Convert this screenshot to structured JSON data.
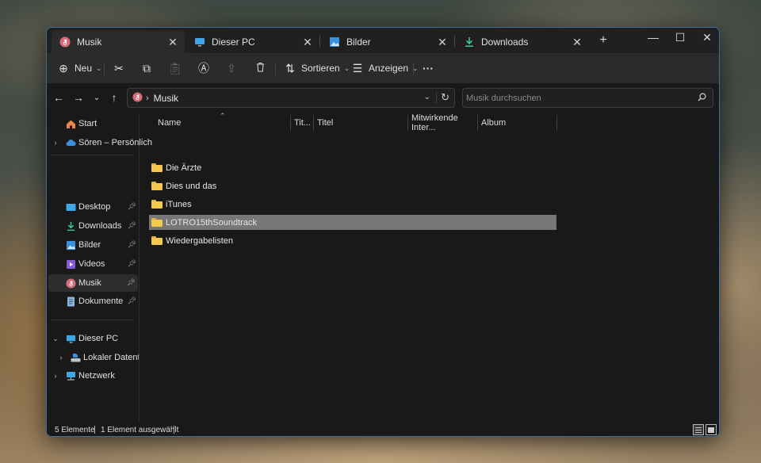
{
  "tabs": [
    {
      "label": "Musik",
      "icon": "music-folder-icon",
      "close": "✕"
    },
    {
      "label": "Dieser PC",
      "icon": "computer-icon",
      "close": "✕"
    },
    {
      "label": "Bilder",
      "icon": "pictures-icon",
      "close": "✕"
    },
    {
      "label": "Downloads",
      "icon": "download-icon",
      "close": "✕"
    }
  ],
  "window_controls": {
    "new_tab": "+",
    "minimize": "—",
    "maximize": "☐",
    "close": "✕"
  },
  "toolbar": {
    "new_label": "Neu",
    "sort_label": "Sortieren",
    "view_label": "Anzeigen",
    "more_label": "···"
  },
  "addressbar": {
    "crumb": "Musik",
    "crumb_sep": "›"
  },
  "search": {
    "placeholder": "Musik durchsuchen"
  },
  "sidebar": {
    "items": [
      {
        "label": "Start"
      },
      {
        "label": "Sören – Persönlich"
      },
      {
        "label": "Desktop"
      },
      {
        "label": "Downloads"
      },
      {
        "label": "Bilder"
      },
      {
        "label": "Videos"
      },
      {
        "label": "Musik"
      },
      {
        "label": "Dokumente"
      },
      {
        "label": "Dieser PC"
      },
      {
        "label": "Lokaler Datenträg"
      },
      {
        "label": "Netzwerk"
      }
    ]
  },
  "columns": [
    "Name",
    "Tit...",
    "Titel",
    "Mitwirkende Inter...",
    "Album"
  ],
  "files": [
    {
      "name": "Die Ärzte",
      "selected": false
    },
    {
      "name": "Dies und das",
      "selected": false
    },
    {
      "name": "iTunes",
      "selected": false
    },
    {
      "name": "LOTRO15thSoundtrack",
      "selected": true
    },
    {
      "name": "Wiedergabelisten",
      "selected": false
    }
  ],
  "status": {
    "count": "5 Elemente",
    "selection": "1 Element ausgewählt"
  },
  "colors": {
    "accent": "#3c6da0",
    "folder": "#f3c94e",
    "selection": "#777777",
    "background": "#191919"
  }
}
